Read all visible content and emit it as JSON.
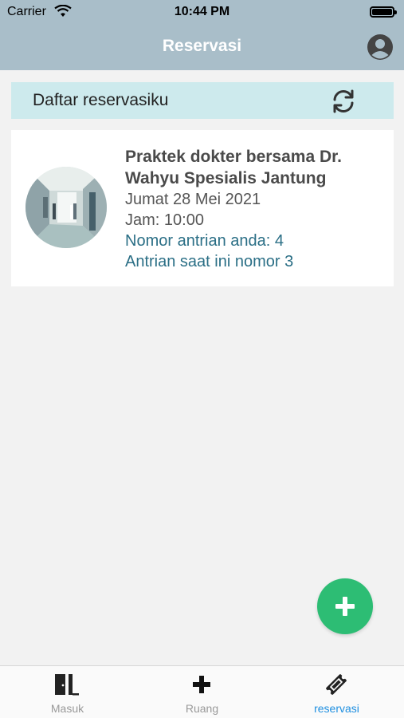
{
  "status_bar": {
    "carrier": "Carrier",
    "time": "10:44 PM",
    "battery_level": 1.0
  },
  "nav": {
    "title": "Reservasi",
    "profile_icon": "user-circle-icon"
  },
  "section": {
    "title": "Daftar reservasiku",
    "refresh_icon": "refresh-icon"
  },
  "reservations": [
    {
      "title": "Praktek dokter bersama Dr. Wahyu Spesialis Jantung",
      "date": "Jumat 28 Mei 2021",
      "time": "Jam: 10:00",
      "queue_number": "Nomor antrian anda: 4",
      "current_queue": "Antrian saat ini nomor 3"
    }
  ],
  "fab": {
    "icon": "plus-icon"
  },
  "tabs": [
    {
      "label": "Masuk",
      "icon": "door-icon",
      "active": false
    },
    {
      "label": "Ruang",
      "icon": "plus-icon",
      "active": false
    },
    {
      "label": "reservasi",
      "icon": "ticket-icon",
      "active": true
    }
  ],
  "colors": {
    "nav_bg": "#a9bec9",
    "header_bg": "#cdeaed",
    "queue_text": "#2b6f86",
    "fab_bg": "#2dbd74",
    "active_tab": "#1e8fe0"
  }
}
